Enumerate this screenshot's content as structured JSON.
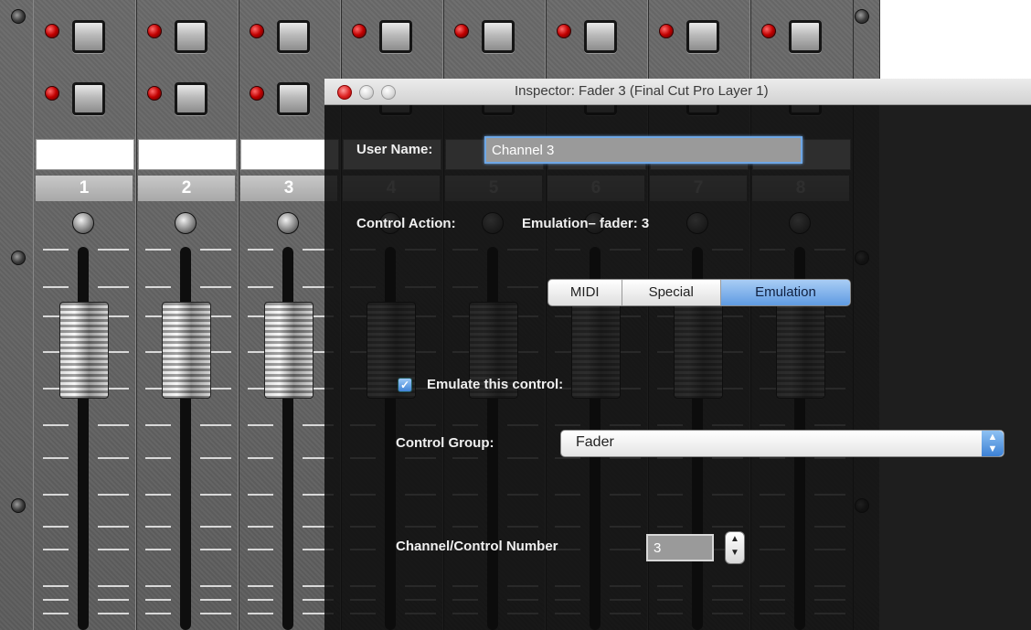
{
  "mixer": {
    "channels": [
      {
        "number": "1"
      },
      {
        "number": "2"
      },
      {
        "number": "3"
      },
      {
        "number": "4"
      },
      {
        "number": "5"
      },
      {
        "number": "6"
      },
      {
        "number": "7"
      },
      {
        "number": "8"
      }
    ]
  },
  "inspector": {
    "title": "Inspector: Fader 3 (Final Cut Pro Layer 1)",
    "user_name_label": "User Name:",
    "user_name_value": "Channel 3",
    "control_action_label": "Control Action:",
    "control_action_value": "Emulation– fader: 3",
    "tabs": [
      {
        "label": "MIDI",
        "active": false
      },
      {
        "label": "Special",
        "active": false
      },
      {
        "label": "Emulation",
        "active": true
      }
    ],
    "emulate_label": "Emulate this control:",
    "emulate_checked": true,
    "control_group_label": "Control Group:",
    "control_group_value": "Fader",
    "channel_number_label": "Channel/Control Number",
    "channel_number_value": "3"
  },
  "colors": {
    "led": "#c00000",
    "selection": "#5f9be2",
    "panel": "#5c5c5c"
  }
}
